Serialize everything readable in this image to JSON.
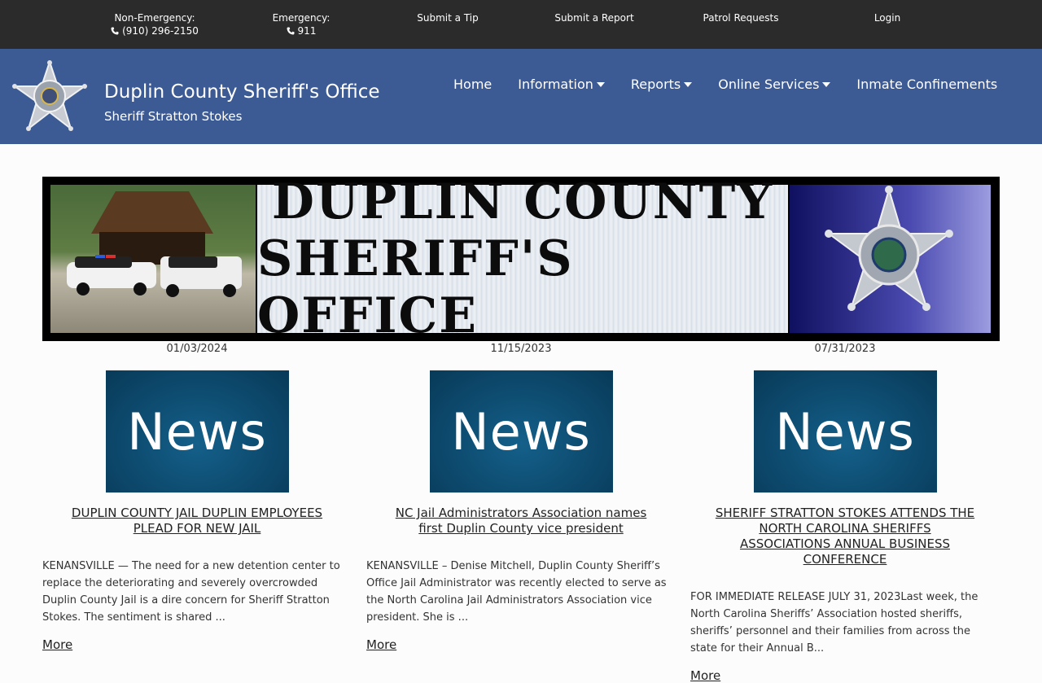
{
  "topbar": {
    "non_emergency_label": "Non-Emergency:",
    "non_emergency_phone": "(910) 296-2150",
    "emergency_label": "Emergency:",
    "emergency_phone": "911",
    "submit_tip": "Submit a Tip",
    "submit_report": "Submit a Report",
    "patrol_requests": "Patrol Requests",
    "login": "Login"
  },
  "header": {
    "title": "Duplin County Sheriff's Office",
    "subtitle": "Sheriff Stratton Stokes"
  },
  "nav": [
    {
      "label": "Home",
      "dropdown": false
    },
    {
      "label": "Information",
      "dropdown": true
    },
    {
      "label": "Reports",
      "dropdown": true
    },
    {
      "label": "Online Services",
      "dropdown": true
    },
    {
      "label": "Inmate Confinements",
      "dropdown": false
    }
  ],
  "banner": {
    "line1": "DUPLIN COUNTY",
    "line2": "SHERIFF'S OFFICE"
  },
  "news": [
    {
      "date": "01/03/2024",
      "thumb": "News",
      "title": "DUPLIN COUNTY JAIL DUPLIN EMPLOYEES PLEAD FOR NEW JAIL",
      "text": "KENANSVILLE — The need for a new detention center to replace the deteriorating and severely overcrowded Duplin County Jail is a dire concern for Sheriff Stratton Stokes. The sentiment is shared ...",
      "more": "More"
    },
    {
      "date": "11/15/2023",
      "thumb": "News",
      "title": "NC Jail Administrators Association names first Duplin County vice president",
      "text": "KENANSVILLE – Denise Mitchell, Duplin County Sheriff’s Office Jail Administrator was recently elected to serve as the North Carolina Jail Administrators Association vice president. She is ...",
      "more": "More"
    },
    {
      "date": "07/31/2023",
      "thumb": "News",
      "title": "SHERIFF STRATTON STOKES ATTENDS THE NORTH CAROLINA SHERIFFS ASSOCIATIONS ANNUAL BUSINESS CONFERENCE",
      "text": "FOR IMMEDIATE RELEASE JULY 31, 2023Last week, the North Carolina Sheriffs’ Association hosted sheriffs, sheriffs’ personnel and their families from across the state for their Annual B...",
      "more": "More"
    }
  ]
}
